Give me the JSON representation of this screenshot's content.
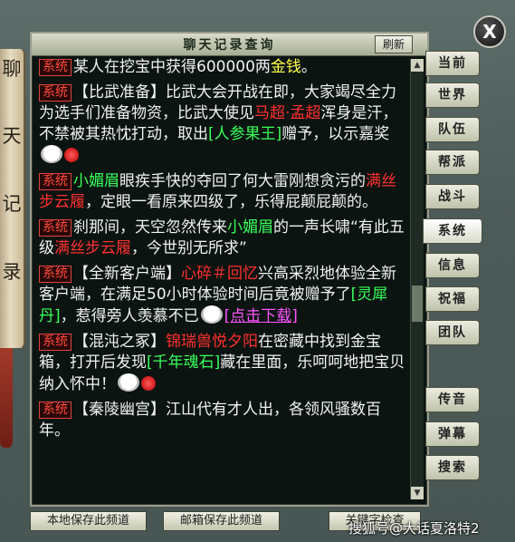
{
  "window": {
    "title": "聊天记录查询",
    "refresh_label": "刷新",
    "close_label": "X"
  },
  "side_scroll": {
    "chars": [
      "聊",
      "天",
      "记",
      "录"
    ]
  },
  "tabs": [
    {
      "label": "当前",
      "active": false
    },
    {
      "label": "世界",
      "active": false
    },
    {
      "label": "队伍",
      "active": false
    },
    {
      "label": "帮派",
      "active": false
    },
    {
      "label": "战斗",
      "active": false
    },
    {
      "label": "系统",
      "active": true
    },
    {
      "label": "信息",
      "active": false
    },
    {
      "label": "祝福",
      "active": false
    },
    {
      "label": "团队",
      "active": false
    },
    {
      "label": "传音",
      "active": false
    },
    {
      "label": "弹幕",
      "active": false
    },
    {
      "label": "搜索",
      "active": false
    }
  ],
  "log": {
    "tag": "系统",
    "entries": [
      {
        "segments": [
          {
            "t": "某人在挖宝中获得600000两",
            "c": "wh"
          },
          {
            "t": "金钱",
            "c": "yw"
          },
          {
            "t": "。",
            "c": "wh"
          }
        ]
      },
      {
        "segments": [
          {
            "t": "【比武准备】比武大会开战在即，大家竭尽全力为选手们准备物资，比武大使见",
            "c": "wh"
          },
          {
            "t": "马超·孟超",
            "c": "rd"
          },
          {
            "t": "浑身是汗，不禁被其热忱打动，取出",
            "c": "wh"
          },
          {
            "t": "[人参果王]",
            "c": "gr"
          },
          {
            "t": "赠予，以示嘉奖",
            "c": "wh"
          }
        ]
      },
      {
        "segments": [
          {
            "t": "小媚眉",
            "c": "gr"
          },
          {
            "t": "眼疾手快的夺回了何大雷刚想贪污的",
            "c": "wh"
          },
          {
            "t": "满丝步云履",
            "c": "rd"
          },
          {
            "t": "，定眼一看原来四级了，乐得屁颠屁颠的。",
            "c": "wh"
          }
        ]
      },
      {
        "segments": [
          {
            "t": "刹那间，天空忽然传来",
            "c": "wh"
          },
          {
            "t": "小媚眉",
            "c": "gr"
          },
          {
            "t": "的一声长啸“有此五级",
            "c": "wh"
          },
          {
            "t": "满丝步云履",
            "c": "rd"
          },
          {
            "t": "，今世别无所求”",
            "c": "wh"
          }
        ]
      },
      {
        "segments": [
          {
            "t": "【全新客户端】",
            "c": "wh"
          },
          {
            "t": "心碎＃回忆",
            "c": "rd"
          },
          {
            "t": "兴高采烈地体验全新客户端，在满足50小时体验时间后竟被赠予了",
            "c": "wh"
          },
          {
            "t": "[灵犀丹]",
            "c": "gr"
          },
          {
            "t": "，惹得旁人羡慕不已",
            "c": "wh"
          },
          {
            "t": "[点击下载]",
            "c": "pk ul"
          }
        ]
      },
      {
        "segments": [
          {
            "t": "【混沌之冢】",
            "c": "wh"
          },
          {
            "t": "锦瑞兽悦夕阳",
            "c": "rd"
          },
          {
            "t": "在密藏中找到金宝箱，打开后发现",
            "c": "wh"
          },
          {
            "t": "[千年魂石]",
            "c": "gr"
          },
          {
            "t": "藏在里面，乐呵呵地把宝贝纳入怀中！",
            "c": "wh"
          }
        ]
      },
      {
        "segments": [
          {
            "t": "【秦陵幽宫】江山代有才人出，各领风骚数百年。",
            "c": "wh"
          }
        ]
      }
    ]
  },
  "bottom": {
    "save_local": "本地保存此频道",
    "save_mail": "邮箱保存此频道",
    "keyword": "关键字检查"
  },
  "watermark": "搜狐号@大话夏洛特2"
}
